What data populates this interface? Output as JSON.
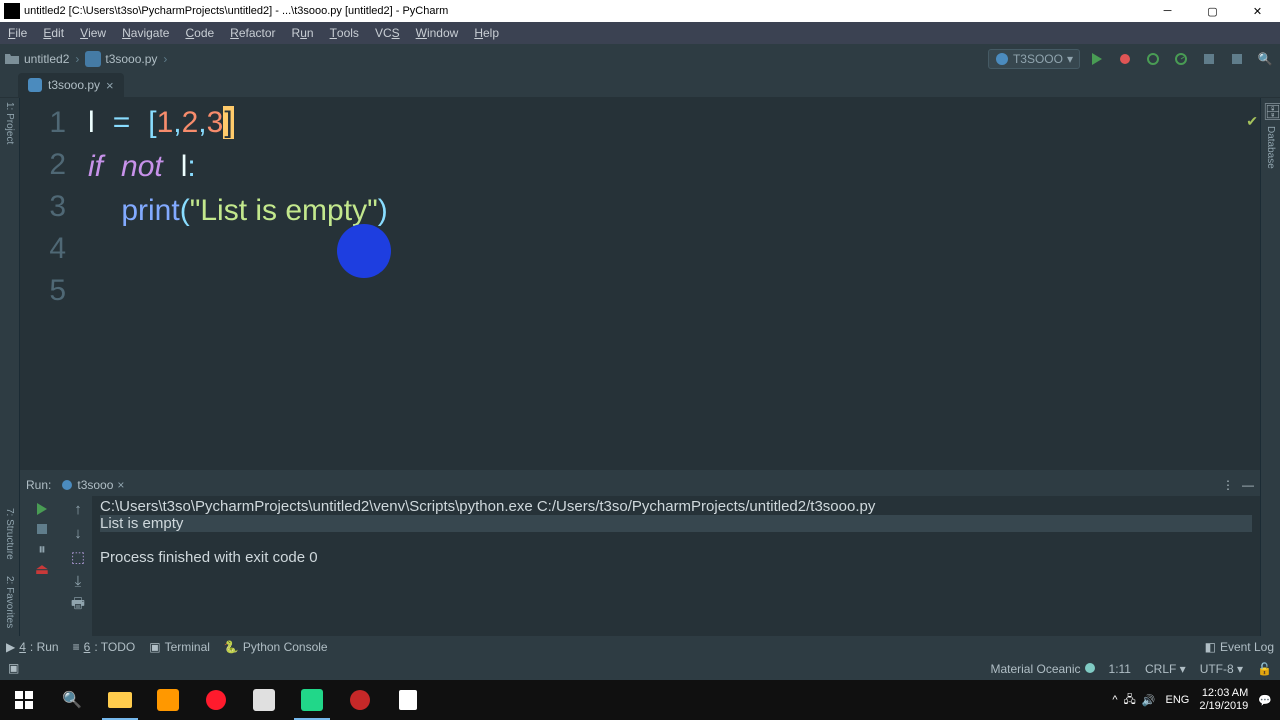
{
  "window": {
    "title": "untitled2 [C:\\Users\\t3so\\PycharmProjects\\untitled2] - ...\\t3sooo.py [untitled2] - PyCharm"
  },
  "menu": [
    "File",
    "Edit",
    "View",
    "Navigate",
    "Code",
    "Refactor",
    "Run",
    "Tools",
    "VCS",
    "Window",
    "Help"
  ],
  "breadcrumb": {
    "project": "untitled2",
    "file": "t3sooo.py"
  },
  "runConfig": "T3SOOO",
  "editorTab": "t3sooo.py",
  "gutter": [
    "1",
    "2",
    "3",
    "4",
    "5"
  ],
  "code": {
    "l1_var": "l",
    "l1_eq": "=",
    "l1_lb": "[",
    "l1_n1": "1",
    "l1_c1": ",",
    "l1_n2": "2",
    "l1_c2": ",",
    "l1_n3": "3",
    "l1_rb": "]",
    "l2_if": "if",
    "l2_not": "not",
    "l2_var": "l",
    "l2_colon": ":",
    "l3_indent": "    ",
    "l3_print": "print",
    "l3_open": "(",
    "l3_str": "\"List is empty\"",
    "l3_close": ")"
  },
  "runPanel": {
    "label": "Run:",
    "tab": "t3sooo",
    "cmd": "C:\\Users\\t3so\\PycharmProjects\\untitled2\\venv\\Scripts\\python.exe C:/Users/t3so/PycharmProjects/untitled2/t3sooo.py",
    "out1": "List is empty",
    "out2": "Process finished with exit code 0"
  },
  "bottomTabs": {
    "run": "4: Run",
    "todo": "6: TODO",
    "terminal": "Terminal",
    "python": "Python Console",
    "eventLog": "Event Log"
  },
  "status": {
    "theme": "Material Oceanic",
    "pos": "1:11",
    "lineEnd": "CRLF",
    "encoding": "UTF-8",
    "lock": "🔒"
  },
  "tray": {
    "lang": "ENG",
    "time": "12:03 AM",
    "date": "2/19/2019"
  }
}
